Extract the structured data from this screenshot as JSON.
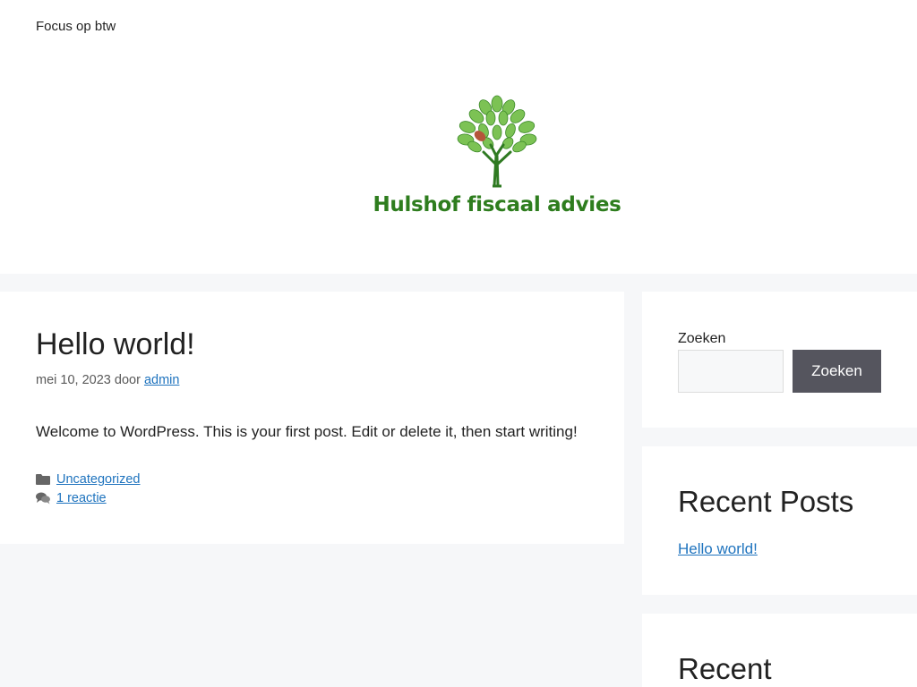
{
  "header": {
    "tagline": "Focus op btw",
    "logo_text": "Hulshof fiscaal advies"
  },
  "post": {
    "title": "Hello world!",
    "date": "mei 10, 2023",
    "by_label": "door",
    "author": "admin",
    "content": "Welcome to WordPress. This is your first post. Edit or delete it, then start writing!",
    "category": "Uncategorized",
    "comments": "1 reactie"
  },
  "sidebar": {
    "search_label": "Zoeken",
    "search_value": "",
    "search_button": "Zoeken",
    "recent_posts_title": "Recent Posts",
    "recent_posts": [
      "Hello world!"
    ],
    "next_widget_title": "Recent"
  },
  "colors": {
    "link": "#1e73be",
    "button_bg": "#55555e",
    "logo_green": "#2e7d1e",
    "page_bg": "#f6f7f9"
  }
}
